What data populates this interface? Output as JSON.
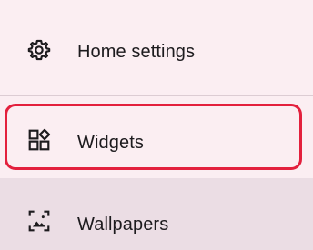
{
  "menu": {
    "items": [
      {
        "label": "Home settings",
        "icon": "gear-icon"
      },
      {
        "label": "Widgets",
        "icon": "widgets-icon"
      },
      {
        "label": "Wallpapers",
        "icon": "wallpaper-icon"
      }
    ]
  },
  "highlight": {
    "target": "Widgets",
    "color": "#e3203d"
  }
}
